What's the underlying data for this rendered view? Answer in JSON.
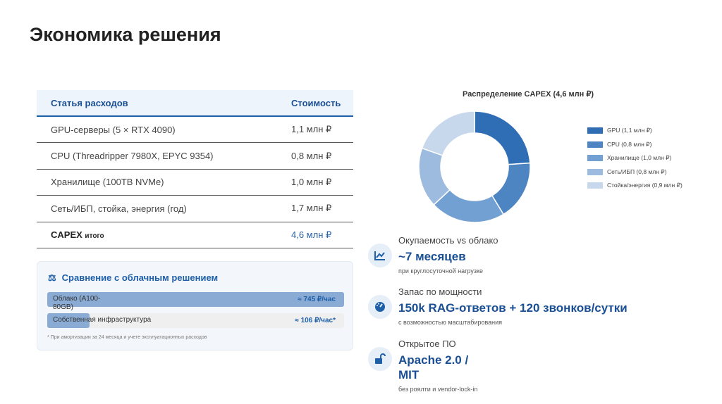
{
  "title": "Экономика решения",
  "table": {
    "headers": [
      "Статья расходов",
      "Стоимость"
    ],
    "rows": [
      [
        "GPU-серверы (5 × RTX 4090)",
        "1,1 млн ₽"
      ],
      [
        "CPU (Threadripper 7980X, EPYC 9354)",
        "0,8 млн ₽"
      ],
      [
        "Хранилище (100TB NVMe)",
        "1,0 млн ₽"
      ],
      [
        "Сеть/ИБП, стойка, энергия (год)",
        "1,7 млн ₽"
      ]
    ],
    "total": {
      "label": "CAPEX",
      "suffix": "итого",
      "value": "4,6 млн ₽"
    }
  },
  "comparison": {
    "icon": "scales-icon",
    "title": "Сравнение с облачным решением",
    "bars": [
      {
        "label": "Облако (A100-80GB)",
        "value": "≈ 745 ₽/час",
        "fill": 1.0
      },
      {
        "label": "Собственная инфраструктура",
        "value": "≈ 106 ₽/час*",
        "fill": 0.142
      }
    ],
    "note": "* При амортизации за 24 месяца и учете эксплуатационных расходов"
  },
  "chart_data": {
    "type": "pie",
    "title": "Распределение CAPEX (4,6 млн ₽)",
    "donut": true,
    "labels": [
      "GPU (1,1 млн ₽)",
      "CPU (0,8 млн ₽)",
      "Хранилище (1,0 млн ₽)",
      "Сеть/ИБП (0,8 млн ₽)",
      "Стойка/энергия (0,9 млн ₽)"
    ],
    "values": [
      1.1,
      0.8,
      1.0,
      0.8,
      0.9
    ],
    "colors": [
      "#2f6db5",
      "#4d84c2",
      "#73a0d2",
      "#9dbbde",
      "#c8d8ec"
    ],
    "legend": "right"
  },
  "kpis": [
    {
      "icon": "chart-line-icon",
      "label": "Окупаемость vs облако",
      "value": "~7 месяцев",
      "sub": "при круглосуточной нагрузке"
    },
    {
      "icon": "gauge-icon",
      "label": "Запас по мощности",
      "value": "150k RAG-ответов + 120 звонков/сутки",
      "sub": "с возможностью масштабирования"
    },
    {
      "icon": "unlock-icon",
      "label": "Открытое ПО",
      "value": "Apache 2.0 / MIT",
      "sub": "без роялти и vendor-lock-in"
    }
  ]
}
